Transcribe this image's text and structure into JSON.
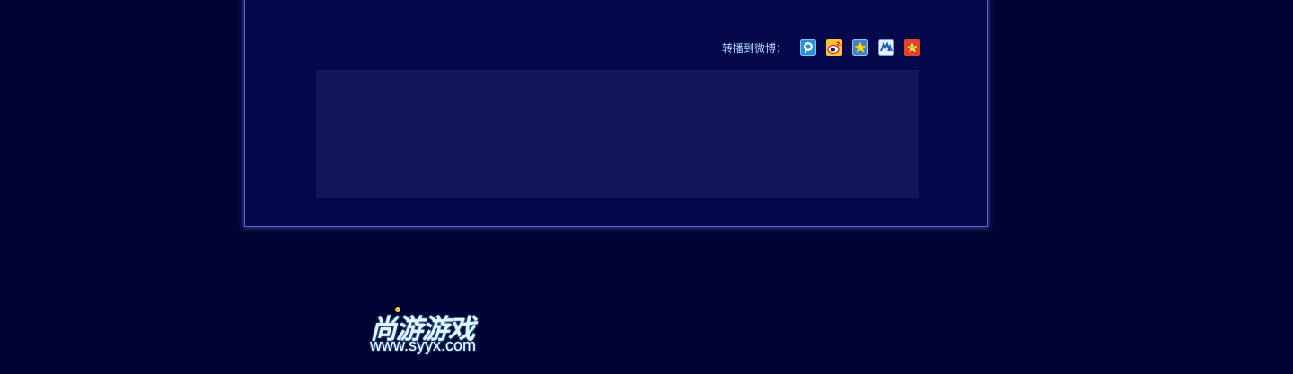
{
  "share": {
    "label": "转播到微博：",
    "icons": [
      {
        "name": "tencent-pengyou-icon",
        "color": "#2b8fd8"
      },
      {
        "name": "sina-weibo-icon",
        "color": "#e6162d"
      },
      {
        "name": "qzone-icon",
        "color": "#f6c000"
      },
      {
        "name": "renren-icon",
        "color": "#1b5fb3"
      },
      {
        "name": "kaixin-icon",
        "color": "#e2452a"
      }
    ]
  },
  "logo": {
    "chinese": "尚游游戏",
    "url": "www.syyx.com"
  },
  "colors": {
    "page_background": "#000434",
    "panel_background": "#05084a",
    "comment_box": "#12165a",
    "panel_border": "#5d64c8",
    "label_text": "#a9d6ff"
  }
}
